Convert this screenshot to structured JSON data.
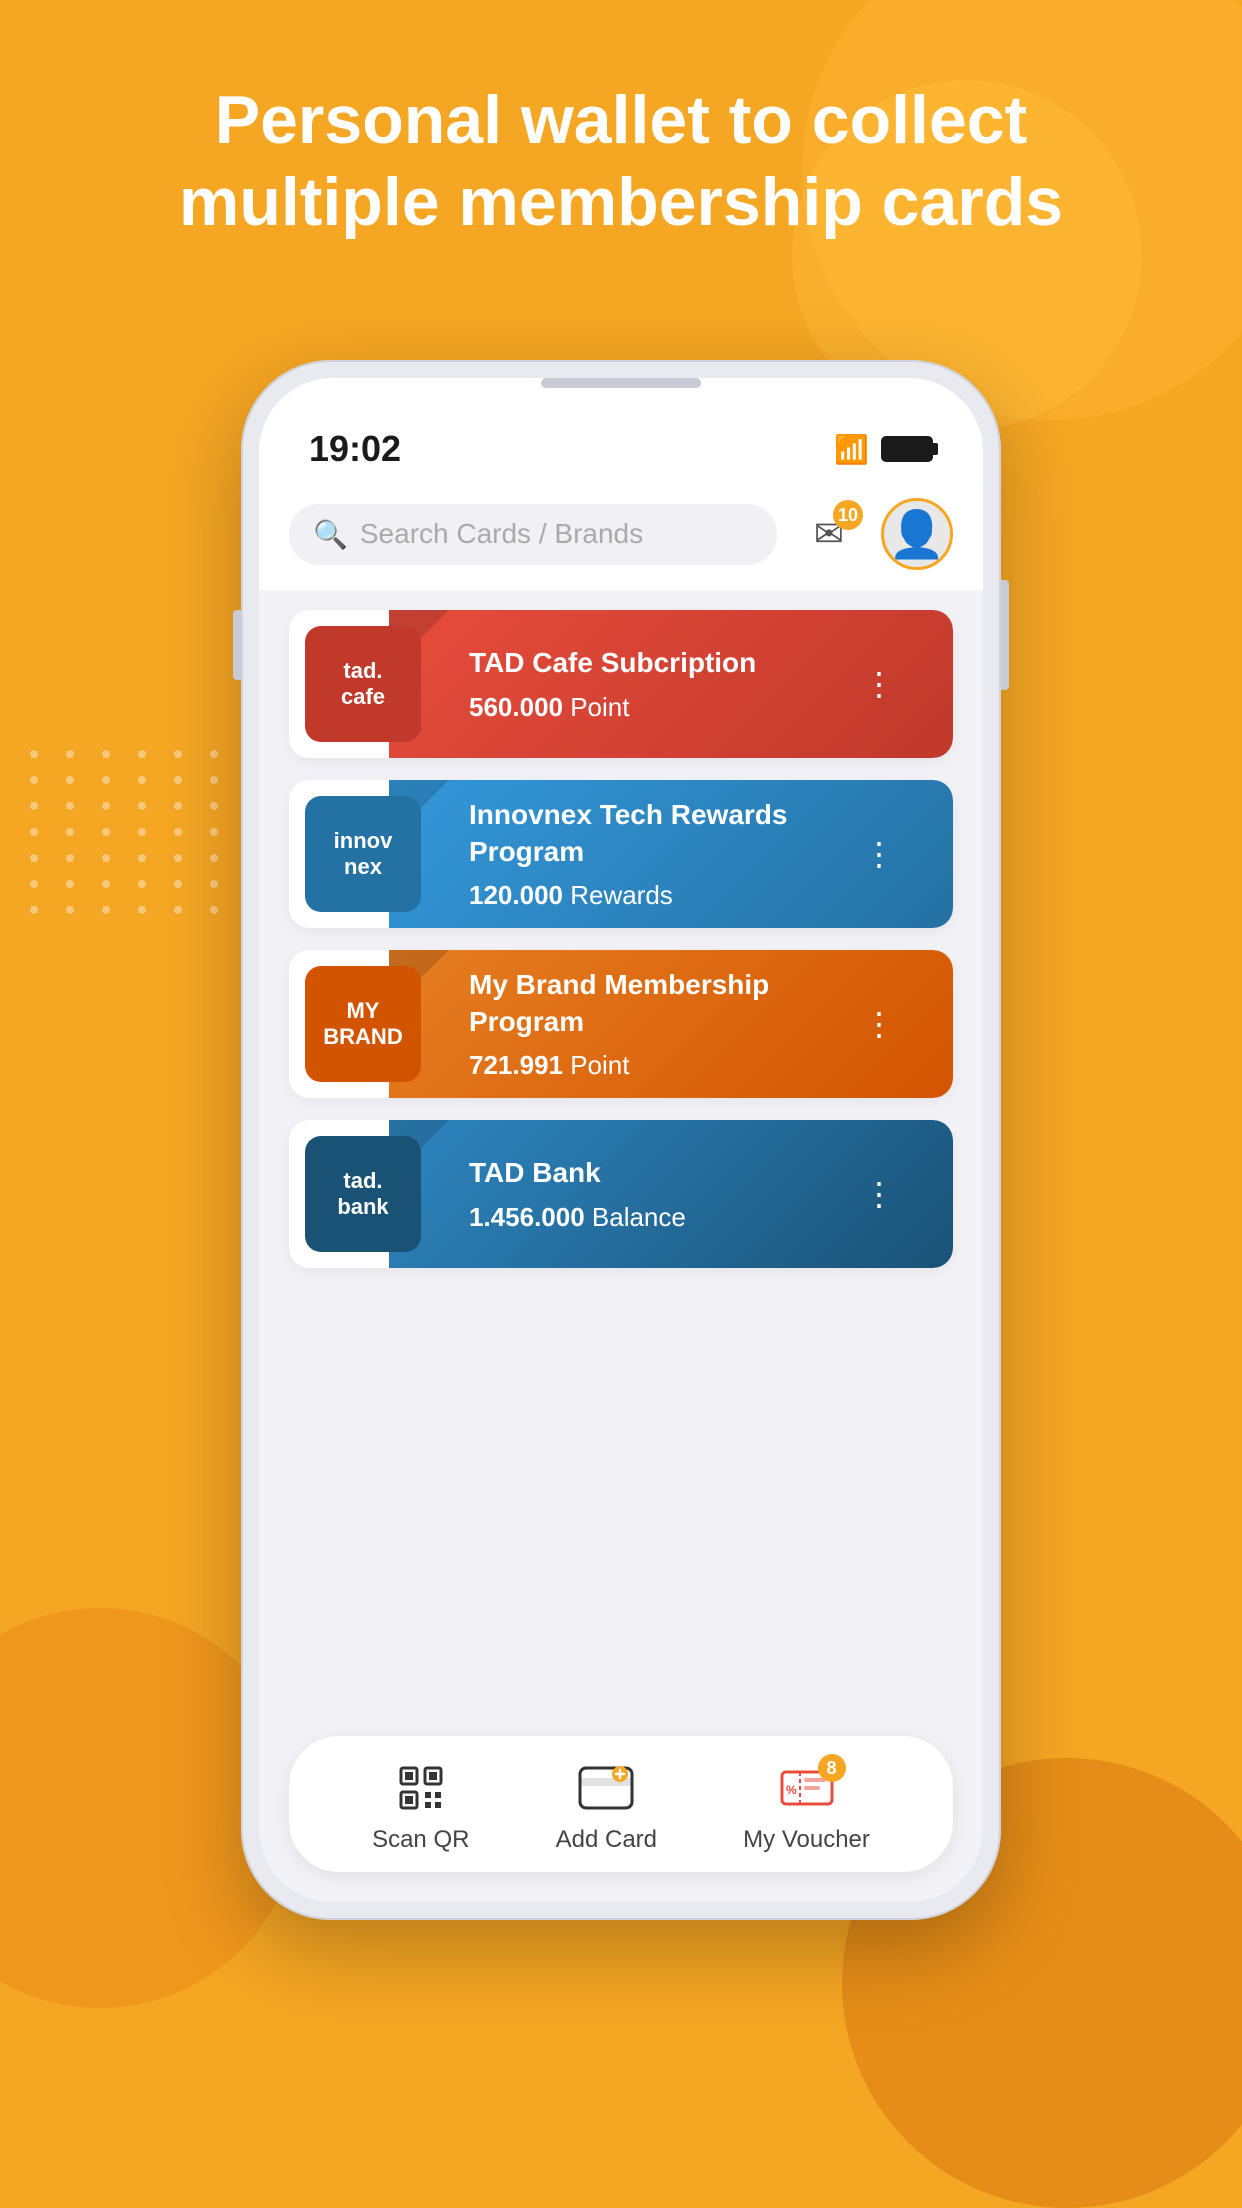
{
  "page": {
    "background_color": "#F5A623"
  },
  "hero": {
    "title": "Personal wallet to collect multiple membership cards"
  },
  "phone": {
    "status_bar": {
      "time": "19:02"
    },
    "search": {
      "placeholder": "Search Cards / Brands"
    },
    "notifications": {
      "count": "10"
    },
    "cards": [
      {
        "brand_name": "tad. cafe",
        "brand_color": "#C0392B",
        "strip_color": "#E74C3C",
        "card_title": "TAD Cafe Subcription",
        "points_value": "560.000",
        "points_label": "Point"
      },
      {
        "brand_name": "innov nex",
        "brand_color": "#2980B9",
        "strip_color": "#3498DB",
        "card_title": "Innovnex Tech Rewards Program",
        "points_value": "120.000",
        "points_label": "Rewards"
      },
      {
        "brand_name": "MY BRAND",
        "brand_color": "#D35400",
        "strip_color": "#E67E22",
        "card_title": "My Brand Membership Program",
        "points_value": "721.991",
        "points_label": "Point"
      },
      {
        "brand_name": "tad. bank",
        "brand_color": "#1A5276",
        "strip_color": "#2E86C1",
        "card_title": "TAD Bank",
        "points_value": "1.456.000",
        "points_label": "Balance"
      }
    ],
    "bottom_nav": [
      {
        "icon": "scan-qr",
        "label": "Scan QR",
        "badge": null
      },
      {
        "icon": "add-card",
        "label": "Add Card",
        "badge": null
      },
      {
        "icon": "my-voucher",
        "label": "My Voucher",
        "badge": "8"
      }
    ]
  }
}
